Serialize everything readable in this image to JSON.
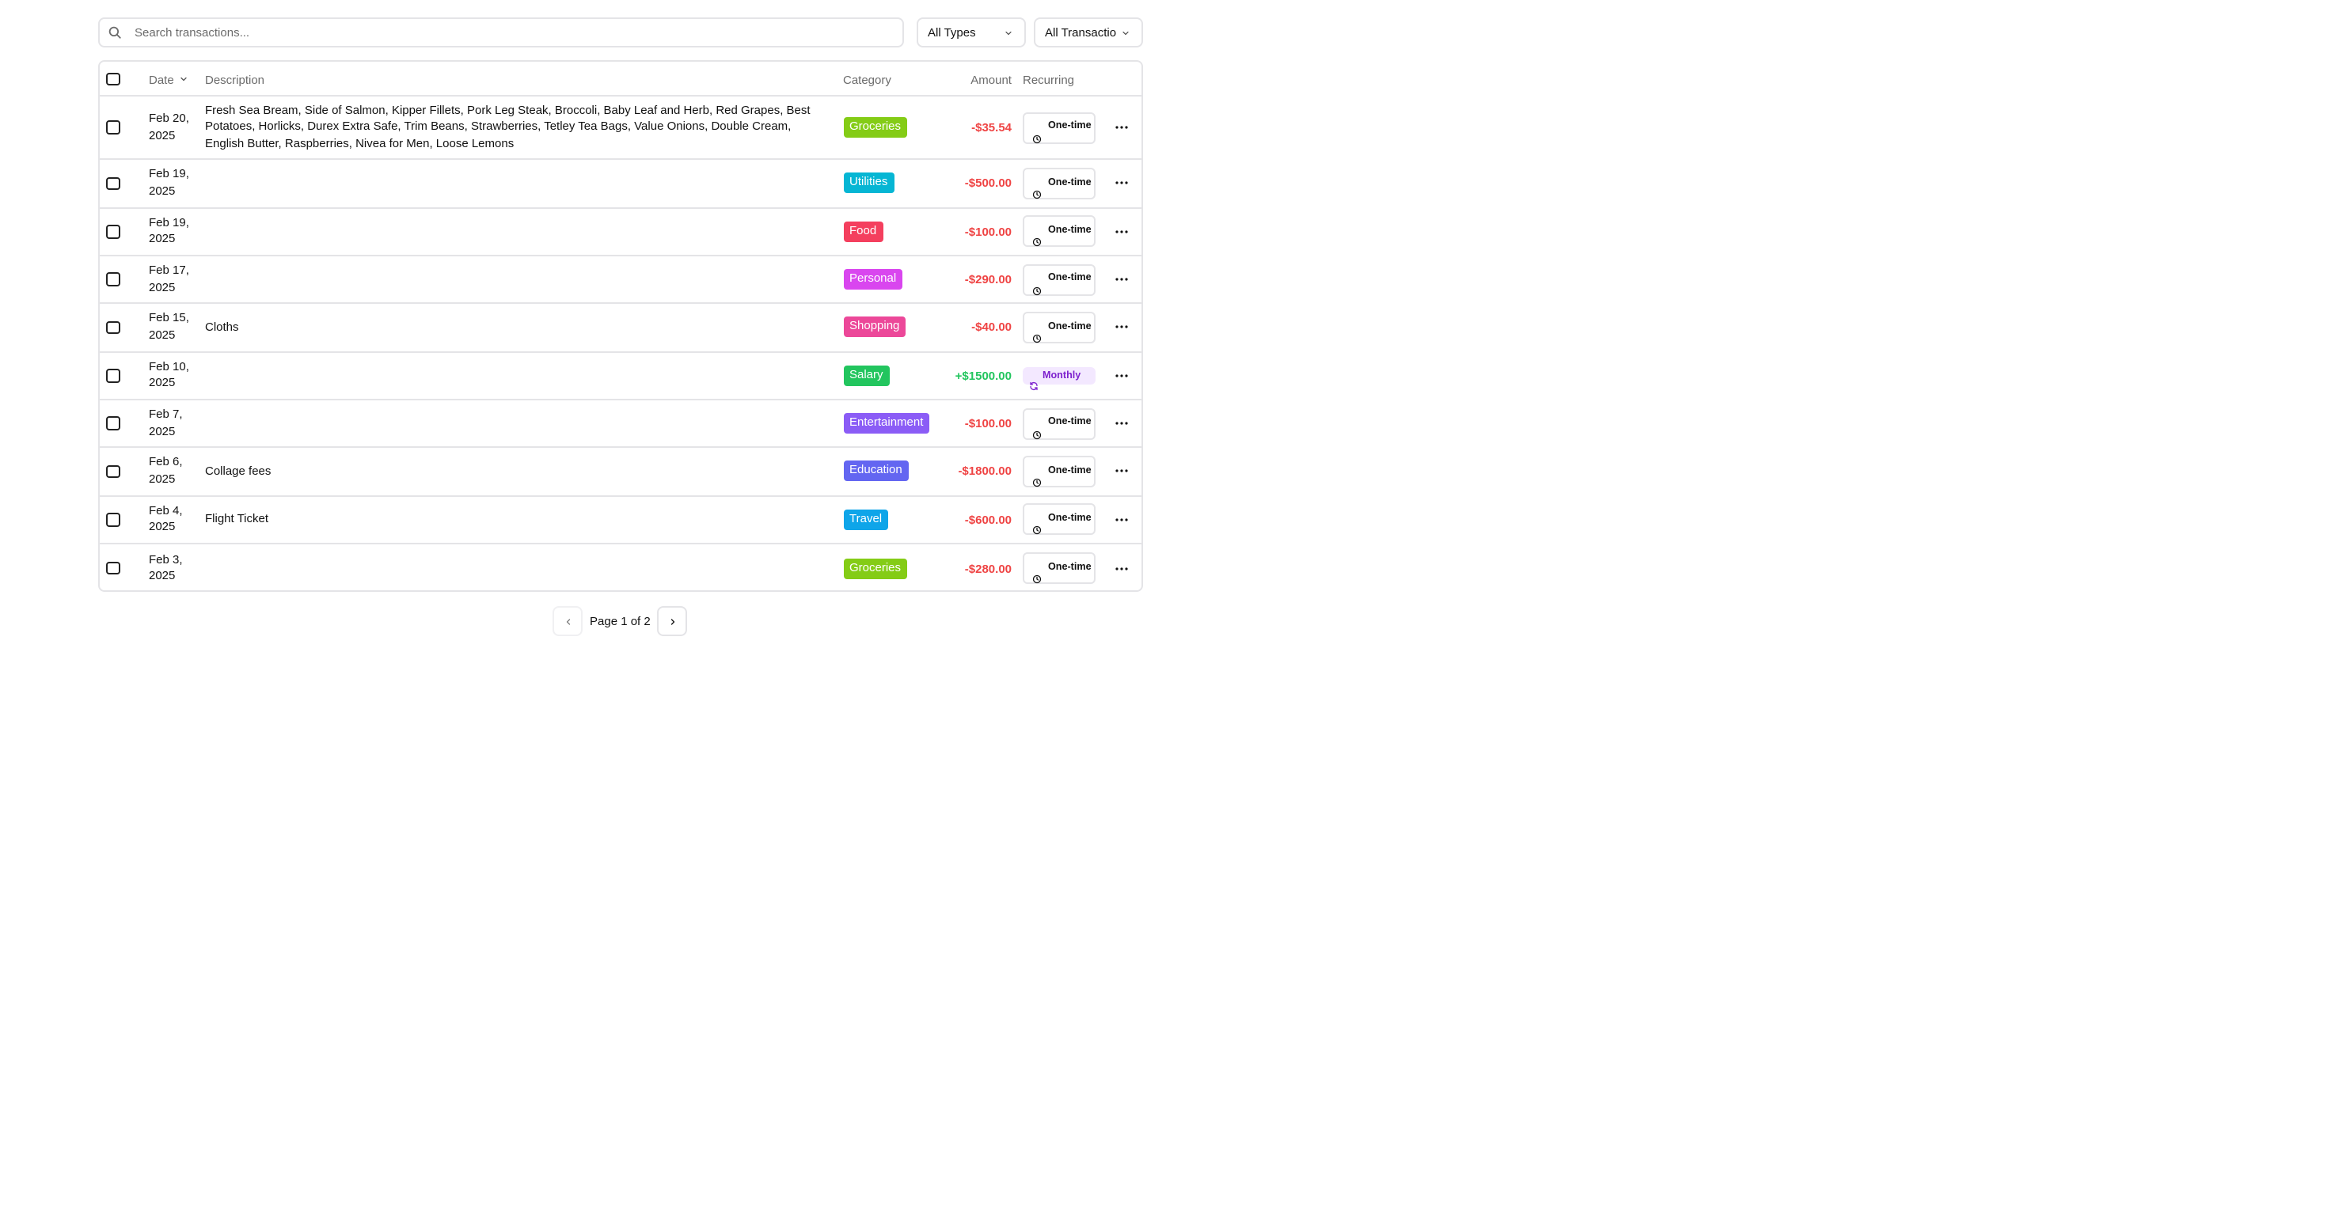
{
  "search": {
    "placeholder": "Search transactions...",
    "icon": "search-icon"
  },
  "filters": {
    "type": {
      "selected": "All Types",
      "icon": "chevron-down-icon"
    },
    "transactions": {
      "selected": "All Transactio",
      "icon": "chevron-down-icon"
    }
  },
  "table": {
    "headers": {
      "date": "Date",
      "description": "Description",
      "category": "Category",
      "amount": "Amount",
      "recurring": "Recurring"
    },
    "rows": [
      {
        "date": "Feb 20, 2025",
        "description": "Fresh Sea Bream, Side of Salmon, Kipper Fillets, Pork Leg Steak, Broccoli, Baby Leaf and Herb, Red Grapes, Best Potatoes, Horlicks, Durex Extra Safe, Trim Beans, Strawberries, Tetley Tea Bags, Value Onions, Double Cream, English Butter, Raspberries, Nivea for Men, Loose Lemons",
        "category": "Groceries",
        "category_color": "#84cc16",
        "amount": "-$35.54",
        "amount_color": "#ef4444",
        "recurring": "One-time",
        "recurring_kind": "one-time"
      },
      {
        "date": "Feb 19, 2025",
        "description": "",
        "category": "Utilities",
        "category_color": "#06b6d4",
        "amount": "-$500.00",
        "amount_color": "#ef4444",
        "recurring": "One-time",
        "recurring_kind": "one-time"
      },
      {
        "date": "Feb 19, 2025",
        "description": "",
        "category": "Food",
        "category_color": "#f43f5e",
        "amount": "-$100.00",
        "amount_color": "#ef4444",
        "recurring": "One-time",
        "recurring_kind": "one-time"
      },
      {
        "date": "Feb 17, 2025",
        "description": "",
        "category": "Personal",
        "category_color": "#d946ef",
        "amount": "-$290.00",
        "amount_color": "#ef4444",
        "recurring": "One-time",
        "recurring_kind": "one-time"
      },
      {
        "date": "Feb 15, 2025",
        "description": "Cloths",
        "category": "Shopping",
        "category_color": "#ec4899",
        "amount": "-$40.00",
        "amount_color": "#ef4444",
        "recurring": "One-time",
        "recurring_kind": "one-time"
      },
      {
        "date": "Feb 10, 2025",
        "description": "",
        "category": "Salary",
        "category_color": "#22c55e",
        "amount": "+$1500.00",
        "amount_color": "#22c55e",
        "recurring": "Monthly",
        "recurring_kind": "monthly"
      },
      {
        "date": "Feb 7, 2025",
        "description": "",
        "category": "Entertainment",
        "category_color": "#8b5cf6",
        "amount": "-$100.00",
        "amount_color": "#ef4444",
        "recurring": "One-time",
        "recurring_kind": "one-time"
      },
      {
        "date": "Feb 6, 2025",
        "description": "Collage fees",
        "category": "Education",
        "category_color": "#6366f1",
        "amount": "-$1800.00",
        "amount_color": "#ef4444",
        "recurring": "One-time",
        "recurring_kind": "one-time"
      },
      {
        "date": "Feb 4, 2025",
        "description": "Flight Ticket",
        "category": "Travel",
        "category_color": "#0ea5e9",
        "amount": "-$600.00",
        "amount_color": "#ef4444",
        "recurring": "One-time",
        "recurring_kind": "one-time"
      },
      {
        "date": "Feb 3, 2025",
        "description": "",
        "category": "Groceries",
        "category_color": "#84cc16",
        "amount": "-$280.00",
        "amount_color": "#ef4444",
        "recurring": "One-time",
        "recurring_kind": "one-time"
      }
    ]
  },
  "pagination": {
    "label": "Page 1 of 2",
    "prev_icon": "chevron-left-icon",
    "next_icon": "chevron-right-icon"
  }
}
